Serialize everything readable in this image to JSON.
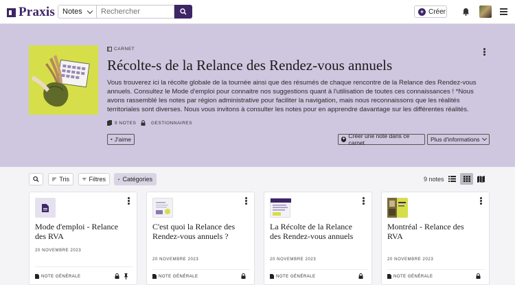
{
  "app": {
    "name": "Praxis"
  },
  "topbar": {
    "scope": "Notes",
    "search_placeholder": "Rechercher",
    "create_label": "Créer"
  },
  "notebook": {
    "type_label": "CARNET",
    "title": "Récolte-s de la Relance des Rendez-vous annuels",
    "description": "Vous trouverez ici la récolte globale de la tournée ainsi que des résumés de chaque rencontre de la Relance des Rendez-vous annuels. Consultez le Mode d'emploi pour connaitre nos suggestions quant à l'utilisation de toutes ces connaissances ! *Nous avons rassemblé les notes par région administrative pour faciliter la navigation, mais nous reconnaissons que les réalités territoriales sont diverses. Nous vous invitons à consulter les notes pour en apprendre davantage sur les différentes réalités.",
    "notes_count_label": "9 NOTES",
    "managers_label": "GESTIONNAIRES",
    "like_label": "J'aime",
    "create_note_label": "Créer une note dans ce carnet",
    "more_info_label": "Plus d'informations"
  },
  "toolbar": {
    "sort_label": "Tris",
    "filters_label": "Filtres",
    "categories_label": "Catégories",
    "count_label": "9 notes",
    "active_view": "grid"
  },
  "cards": [
    {
      "title": "Mode d'emploi - Relance des RVA",
      "date": "20 NOVEMBRE 2023",
      "note_type": "NOTE GÉNÉRALE",
      "thumb_icon": "document-icon",
      "pinned": true
    },
    {
      "title": "C'est quoi la Relance des Rendez-vous annuels ?",
      "date": "20 NOVEMBRE 2023",
      "note_type": "NOTE GÉNÉRALE",
      "thumb_icon": "image-thumbnail",
      "pinned": false
    },
    {
      "title": "La Récolte de la Relance des Rendez-vous annuels",
      "date": "20 NOVEMBRE 2023",
      "note_type": "NOTE GÉNÉRALE",
      "thumb_icon": "image-thumbnail",
      "pinned": false
    },
    {
      "title": "Montréal - Relance des RVA",
      "date": "20 NOVEMBRE 2023",
      "note_type": "NOTE GÉNÉRALE",
      "thumb_icon": "image-thumbnail",
      "pinned": false
    }
  ],
  "colors": {
    "brand": "#3d2566",
    "hero_bg": "#cfc7df",
    "hero_image_bg": "#d6de4a"
  }
}
